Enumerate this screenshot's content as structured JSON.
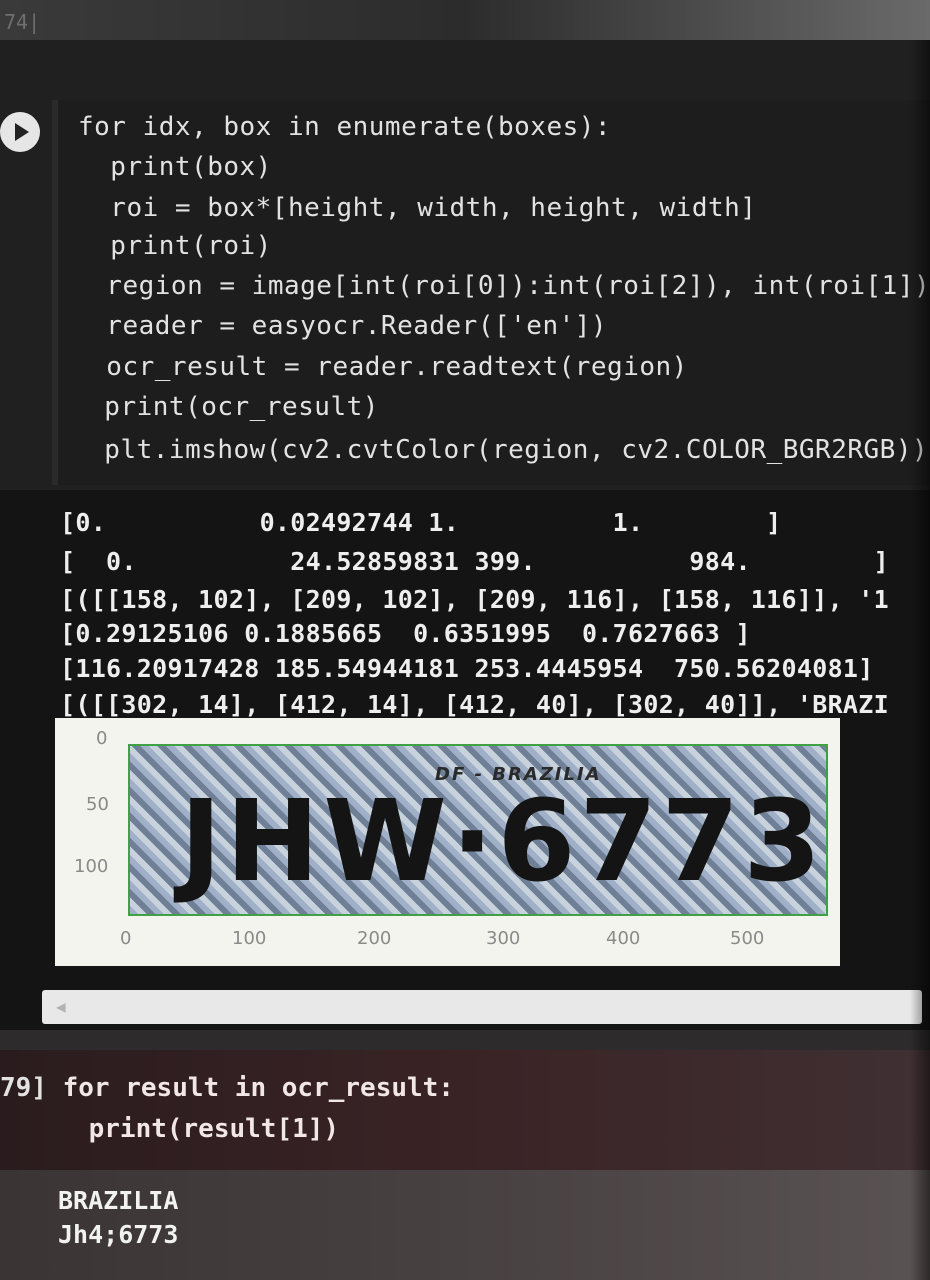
{
  "top": {
    "exec_count": "74|"
  },
  "cell1": {
    "code": [
      "for idx, box in enumerate(boxes):",
      "  print(box)",
      "  roi = box*[height, width, height, width]",
      "  print(roi)",
      "  region = image[int(roi[0]):int(roi[2]), int(roi[1]):",
      "  reader = easyocr.Reader(['en'])",
      "  ocr_result = reader.readtext(region)",
      "  print(ocr_result)",
      "  plt.imshow(cv2.cvtColor(region, cv2.COLOR_BGR2RGB))"
    ]
  },
  "output": {
    "lines": [
      "[0.          0.02492744 1.          1.        ]",
      "[  0.          24.52859831 399.          984.        ]",
      "[([[158, 102], [209, 102], [209, 116], [158, 116]], '1",
      "[0.29125106 0.1885665  0.6351995  0.7627663 ]",
      "[116.20917428 185.54944181 253.4445954  750.56204081]",
      "[([[302, 14], [412, 14], [412, 40], [302, 40]], 'BRAZI"
    ],
    "plot": {
      "y_ticks": [
        "0",
        "50",
        "100"
      ],
      "x_ticks": [
        "0",
        "100",
        "200",
        "300",
        "400",
        "500"
      ],
      "plate_top_text": "DF - BRAZILIA",
      "plate_main_text": "JHW·6773"
    }
  },
  "cell2": {
    "exec_label": "79]",
    "line1": "for result in ocr_result:",
    "line2": "    print(result[1])"
  },
  "result": {
    "lines": [
      "BRAZILIA",
      "Jh4;6773"
    ]
  }
}
